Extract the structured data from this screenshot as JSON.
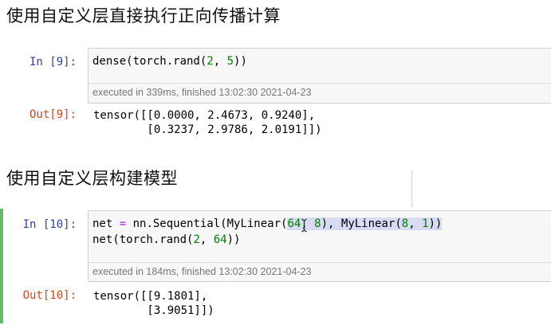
{
  "sections": [
    {
      "title": "使用自定义层直接执行正向传播计算"
    },
    {
      "title": "使用自定义层构建模型"
    }
  ],
  "cells": [
    {
      "in_prompt": "In [9]:",
      "code": {
        "line1": {
          "a": "dense(torch.rand(",
          "n1": "2",
          "b": ", ",
          "n2": "5",
          "c": "))"
        }
      },
      "exec_info": "executed in 339ms, finished 13:02:30 2021-04-23",
      "out_prompt": "Out[9]:",
      "output": {
        "line1": "tensor([[0.0000, 2.4673, 0.9240],",
        "line2": "        [0.3237, 2.9786, 2.0191]])"
      }
    },
    {
      "in_prompt": "In [10]:",
      "code": {
        "line1": {
          "a": "net ",
          "op": "=",
          "b": " nn.Sequential(MyLinear(",
          "n1": "64",
          "c": ", ",
          "n2": "8",
          "d": "), MyLinear(",
          "n3": "8",
          "e": ", ",
          "n4": "1",
          "f": "))"
        },
        "line2": {
          "a": "net(torch.rand(",
          "n1": "2",
          "b": ", ",
          "n2": "64",
          "c": "))"
        }
      },
      "exec_info": "executed in 184ms, finished 13:02:30 2021-04-23",
      "out_prompt": "Out[10]:",
      "output": {
        "line1": "tensor([[9.1801],",
        "line2": "        [3.9051]])"
      }
    }
  ],
  "colors": {
    "in_prompt": "#303f9f",
    "out_prompt": "#d84315",
    "number": "#008000",
    "operator": "#aa22ff",
    "selected_cell_bar": "#66bb6a",
    "highlight": "#d7dcf2"
  },
  "icons": {
    "cursor": "text-cursor-icon"
  }
}
